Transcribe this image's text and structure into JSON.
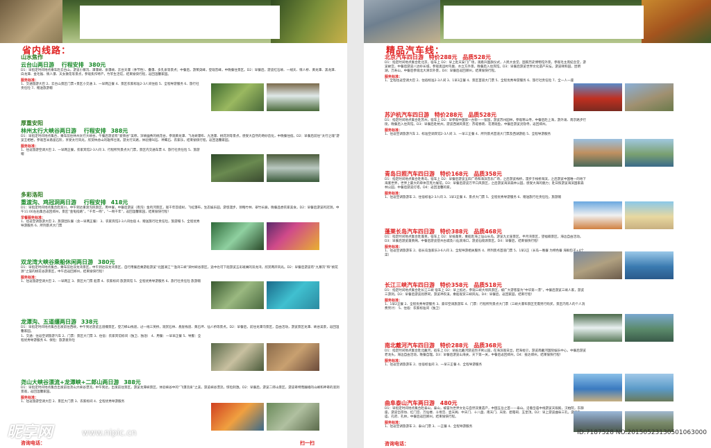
{
  "left": {
    "title": "省内线路：",
    "sections": [
      {
        "region": "山水焦作",
        "route": "云台山两日游",
        "itinerary_label": "行程安排",
        "price": "380元",
        "text": "D1：早指定时间地点乘车赴云台山，游览小寨沟、潭瀑峡、泉瀑峡、云台天瀑（季节性）、叠瀑、多孔泉等景点；中餐后，游茱萸峰，登观音峰，中晚餐住景区。D2：早餐后，游览红石峡、一线天、情人桥、黄龙潭、黑龙潭、白龙潭、金毛猴、情人瀑、天女散花等景点，参观焦作特产，竹竿生活馆，结束愉快行程，返回温馨家园。",
        "std_label": "服务标准：",
        "std": "1、交通旅游大巴 2、云台山景区门票+景区小交通 3、一早两正餐 4、景区农家标准2-3人间住宿 5、全程导游服务 6、旅行社责任险 7、赠送旅游帽"
      },
      {
        "region": "厚重安阳",
        "route": "林州太行大峡谷两日游",
        "itinerary_label": "行程安排",
        "price": "388元",
        "text": "D1：早指定时间地点集合，乘车前往林州太行大峡谷，午餐后游览有“爱情谷”美称，深峡幽秀的桃花谷，参观黄龙潭、飞龙峡瀑布、九连瀑、桃花洞等景点，感受大自然的奇妙造化，中晚餐住宿。D2：早餐后前往“太行之魂”游览王相岩，参观百米悬崖石阶，享受太行风光，欣赏林虑山的雄伟壮观，游太行天路，体验猪叫石、神鹰石、农家乐，结束愉快行程，返回温馨家园。",
        "std_label": "服务标准：",
        "std": "1、往返旅游空调大巴 2、一早两正餐，农家宾馆2-3人间 3、行程所列景点大门票，景区内交通车票 4、旅行社责任险 5、旅游帽"
      },
      {
        "region": "多彩洛阳",
        "route": "重渡沟、鸡冠洞两日游",
        "itinerary_label": "行程安排",
        "price": "418元",
        "text": "D1：早指定时间地点集合赴栾川，中午到达重渡沟风景区，用中餐，中餐后游览（南沟）金鸡河景区，观千年菩提树，飞虹瀑布，生态娱乐园，游悠漫步，领略竹林、翠竹长廊，晚餐品尝农家美食。D2：早餐后游览鸡冠洞，中午11:00左右集合返回郑州，景区“金龟指路”，“千年一吻”，“一吻千年”，返回温馨家园，结束愉快行程！",
        "std_label": "早餐服务标准：",
        "std": "1、往返空调旅游大巴 2、旅游团队餐（含一早两正餐） 3、农家宾馆2-3人间住宿 4、赠送旅行社责任险，旅游帽 5、全程优秀导游服务 6、所列景点大门票"
      },
      {
        "region": "",
        "route": "双龙湾大峡谷乘船休闲两日游",
        "itinerary_label": "",
        "price": "380元",
        "text": "D1：早指定时间地点集合，乘车前往双龙湾景区，中午到达双龙湾景区，自行用餐后乘游船游览“北国漓江”“渔湾三峡”梁村峡谷景区，途中也可下船游览五彩斑斓的双龙湾，欣赏两岸风光。D2：早餐后游览有“九寨沟”和“桃花源”之誉的桃花谷游景区，中午后返回郑州，结束愉快行程！",
        "std_label": "服务标准：",
        "std": "1、往返旅游空调大巴 2、一早两正 3、景区大门票 船票 4、农家标间 旅游宾馆 5、全程优秀导游服务 6、旅行社责任险 旅游帽"
      },
      {
        "region": "",
        "route": "龙潭沟、五道缰两日游",
        "itinerary_label": "",
        "price": "338元",
        "text": "D1：早指定时间地点集合出发前往西峡，中午到达游览五道缰景区，登刀梯山栈道，过一线三英桥，观赏石林、悬崖栈道、黄石坪、仙人桥等景点。D2：早餐后，前往龙潭沟景区，自由活动，游览景区龙潭、峡谷美景，返回温馨家园。",
        "std_label": "",
        "std": "1、交通：往返空调旅游汽车 2、门票：景区大门票 3、住宿：农家宾馆标间（独卫、独浴） 4、用餐：一早早正餐 5、导服：全程优秀导游服务 6、保险：旅游意外险"
      },
      {
        "region": "",
        "route": "尧山大峡谷漂流+龙潭峡+二郎山两日游",
        "itinerary_label": "",
        "price": "388元",
        "text": "D1：早指定时间地点集合出发前往尧山大峡谷漂流，中午到达，出发前往景区，游览龙潭峡景区，体验峡谷中的“飞瀑流泉”之美，游览峡谷漂流，惊险刺激。D2：早餐后，游览二郎山景区，游览奇特而巍峨的山峰和神奇的溶洞景观，返回温馨家园。",
        "std_label": "服务标准：",
        "std": "1、往返旅游空调大巴 2、景区大门票 3、农家标间 4、全程优秀导游服务"
      }
    ],
    "foot_left": "咨询电话：",
    "foot_right": "扫一扫"
  },
  "right": {
    "title": "精品汽车线：",
    "sections": [
      {
        "route": "北京汽车四日游",
        "special": "特价288元",
        "quality": "品质528元",
        "text": "D1：指定时间地点集合赴北京，宿车上 D2：早上赴天安门广场，观看升国旗仪式，人民大会堂，国家历史博物馆外景，参观毛主席纪念堂，游览故宫，中餐后游览八达岭长城，参观奥运村鸟巢、水立方外景，晚餐后入住宾馆。D3：早餐后游览世界文化遗产天坛，游览颐和园，昆明湖，万寿山，中餐后参观北大清华外景，D4：早餐后返回郑州，结束愉快行程。",
        "std_label": "服务标准：",
        "std": "1、全程往返空调大巴 2、住宿标准2-3人间 3、1早3正餐 4、景区首道大门票 5、全程优秀导游服务 6、旅行社责任险 7、全一人一座"
      },
      {
        "route": "苏沪杭汽车四日游",
        "special": "特价288元",
        "quality": "品质528元",
        "text": "D1：指定时间地点集合赴苏州，宿车上 D2：早参观中国第一古街——留园，游览苏州园林，参观寒山寺，中餐后赴上海，游外滩、南京路步行街，晚餐后入住宾馆。D3：早餐后赴杭州，游览西湖风景区：苏堤春晓、花港观鱼，中餐后游览灵隐寺，返回郑州。",
        "std_label": "服务标准：",
        "std": "1、往返空调旅游汽车 2、标准空调宾馆2-3人间 3、一早三正餐 4、所列景点首道大门票及西湖游船 5、全程导游服务"
      },
      {
        "route": "青岛日照汽车四日游",
        "special": "特价168元",
        "quality": "品质358元",
        "text": "D1：指定时间地点集合赴青岛，宿车上 D2：早餐后游览五四广场和海滨音乐广场，之后游览栈桥，漫步于栈桥海滨，之后游览中国唯一的地下海底世界，世界上最大的单体宫克力展馆。D3：早餐后游览万平口风景区，之后游览海滨森林公园，感受大海的魅力；赴日照游览海滨国家森林公园，中餐后游览灯塔，D4：返回温馨的家。",
        "std_label": "服务标准：",
        "std": "1、往返空调旅游车 2、住宿标准2-3人间 3、1早3正餐 4、景点大门票 5、全程优秀导游服务 6、赠送旅行社责任险，旅游帽"
      },
      {
        "route": "蓬莱长岛汽车四日游",
        "special": "特价388元",
        "quality": "品质468元",
        "text": "D1：指定时间地点集合赴蓬莱，宿车上 D2：早抵蓬莱，乘船赴海上仙山长岛，游览九丈崖景区，半月湾景区，望福礁景区，海边自由活动。D3：早餐后游览蓬莱阁，中餐后游览登州古城及八仙渡海口，游览仙境源景区。D4：早餐后，结束愉快行程！",
        "std_label": "服务标准：",
        "std": "1、往返空调旅游车 2、宿长岛渔家乐3-6人间 3、全程导游相关服务 4、所列景点首道门票 5、1早2正（长岛一晚餐 为特色餐 海鲜包子+4个菜）"
      },
      {
        "route": "长江三峡汽车四日游",
        "special": "特价358元",
        "quality": "品质518元",
        "text": "D1：指定时间地点集合赴长江三峡 宿车上 D2：早上抵达，参观三峡大坝风景区，被广大游客誉为“中华第一漂”，中餐后游览三峡人家，游览三游洞。D3：早餐后游览屈原祠，游览神农溪，乘船观赏三峡风光。D4：早餐后，返回家园，结束行程！",
        "std_label": "服务标准：",
        "std": "1、1早2正餐 2、全程优秀导游服务 3、豪华空调旅游车 4、门票：行程所列景点大门票（三峡大瀑布景区无需另行购买，景区内有人的个人消费另计） 5、住宿：农家标准间（独卫）"
      },
      {
        "route": "南北戴河汽车四日游",
        "special": "特价288元",
        "quality": "品质368元",
        "text": "D1：指定时间地点集合赴北戴河，宿车上 D2：早抵北戴河游览鸽子窝公园，在海滨观日出，赶海拾贝，游览南戴河国际娱乐中心，中餐后游览老龙头，海边自由活动，晚餐自理。D3：早餐后游览山海关，天下第一关，中餐后返回郑州，D4：抵达郑州，结束愉快行程！",
        "std_label": "服务标准：",
        "std": "1、往返空调旅游车 2、住宿标准间 3、一早三正餐 4、全程导游服务"
      },
      {
        "route": "曲阜泰山汽车两日游",
        "special": "",
        "quality": "480元",
        "text": "D1：早指定时间地点集合赴泰山，泰山，被誉为世界文化与自然双重遗产，中国五岳之首——泰山。沿着岱庙中线游览天贶殿，汉柏院，东御座，游览岱宗坊、红门宫、万仙楼、斗母宫、壶天阁、中天门、十八盘、南天门、天街、碧霞祠、玉皇顶。D2：早上游览曲阜三孔，游览孔庙、孔府、孔林，中餐后返回郑州，结束愉快行程。",
        "std_label": "服务标准：",
        "std": "1、往返空调旅游车 2、泰山门票 3、一正餐 4、全程导游服务"
      }
    ],
    "foot_left": "咨询电话："
  },
  "watermark": {
    "logo": "昵享网",
    "url": "www.nipic.cn",
    "id": "ID:7187528 NO:20150523130501063000"
  }
}
